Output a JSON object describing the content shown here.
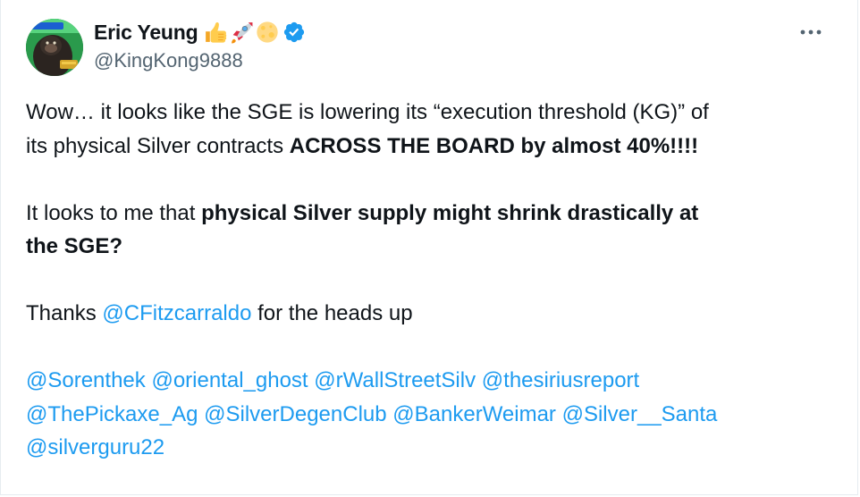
{
  "author": {
    "display_name": "Eric Yeung",
    "handle": "@KingKong9888",
    "name_emojis": [
      "thumbs-up",
      "rocket",
      "full-moon"
    ],
    "verified": true
  },
  "menu": {
    "icon": "more-horizontal-icon"
  },
  "tweet": {
    "para1": {
      "part1": "Wow… it looks like the SGE is lowering its “execution threshold (KG)” of",
      "part2": "its physical Silver contracts ",
      "bold": "ACROSS THE BOARD by almost 40%!!!!"
    },
    "para2": {
      "bold_line1": "physical Silver supply might shrink drastically at",
      "prefix": "It looks to me that ",
      "bold_line2": "the SGE?"
    },
    "para3": {
      "prefix": "Thanks ",
      "mention": "@CFitzcarraldo",
      "suffix": " for the heads up"
    },
    "mentions_line1": [
      "@Sorenthek",
      "@oriental_ghost",
      "@rWallStreetSilv",
      "@thesiriusreport"
    ],
    "mentions_line2": [
      "@ThePickaxe_Ag",
      "@SilverDegenClub",
      "@BankerWeimar",
      "@Silver__Santa"
    ],
    "mentions_line3": [
      "@silverguru22"
    ]
  },
  "colors": {
    "link": "#1d9bf0",
    "text": "#0f1419",
    "secondary": "#536471",
    "verified": "#1d9bf0"
  }
}
